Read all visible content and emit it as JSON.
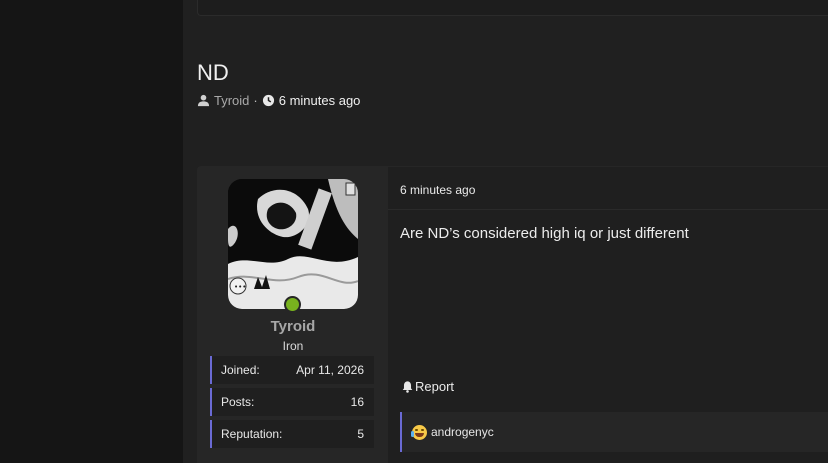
{
  "thread": {
    "title": "ND",
    "author": "Tyroid",
    "separator": "·",
    "time_ago": "6 minutes ago"
  },
  "post": {
    "time_ago": "6 minutes ago",
    "content": "Are ND’s considered high iq or just different",
    "report_label": "Report",
    "reactions": {
      "icon": "joy-emoji-icon",
      "user": "androgenyc"
    }
  },
  "user": {
    "name": "Tyroid",
    "rank": "Iron",
    "online": true,
    "stats": [
      {
        "label": "Joined:",
        "value": "Apr 11, 2026"
      },
      {
        "label": "Posts:",
        "value": "16"
      },
      {
        "label": "Reputation:",
        "value": "5"
      }
    ]
  },
  "colors": {
    "accent": "#6a6ad4",
    "online": "#78b21e",
    "background": "#202020"
  }
}
